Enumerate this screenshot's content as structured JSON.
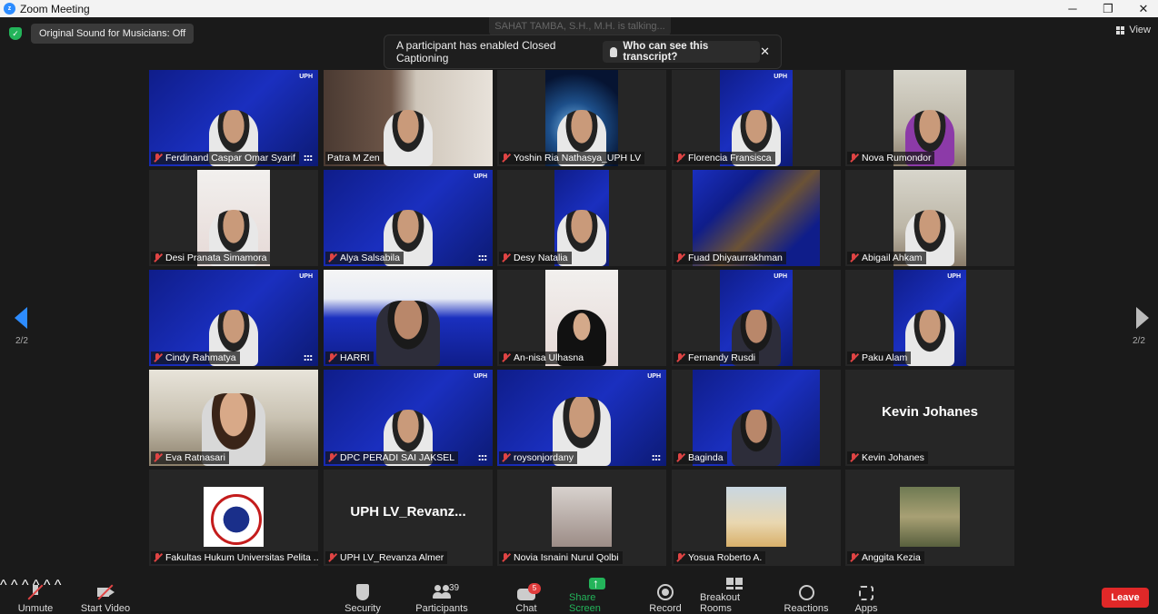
{
  "window": {
    "title": "Zoom Meeting",
    "minimize": "─",
    "maximize": "❐",
    "close": "✕"
  },
  "top": {
    "original_sound": "Original Sound for Musicians: Off",
    "view_label": "View",
    "talking_indicator": "SAHAT TAMBA, S.H., M.H. is talking...",
    "cc_banner": {
      "message": "A participant has enabled Closed Captioning",
      "who_button": "Who can see this transcript?",
      "close": "✕"
    }
  },
  "pagination": {
    "left": "2/2",
    "right": "2/2"
  },
  "tiles": [
    {
      "name": "Ferdinand Caspar Omar Syarif",
      "label": "",
      "brand": "UPH"
    },
    {
      "name": "Patra M Zen",
      "label": "",
      "brand": ""
    },
    {
      "name": "Yoshin Ria Nathasya_UPH LV",
      "label": "",
      "brand": ""
    },
    {
      "name": "Florencia Fransisca",
      "label": "",
      "brand": "UPH"
    },
    {
      "name": "Nova Rumondor",
      "label": "",
      "brand": ""
    },
    {
      "name": "Desi Pranata Simamora",
      "label": "",
      "brand": ""
    },
    {
      "name": "Alya Salsabila",
      "label": "",
      "brand": "UPH"
    },
    {
      "name": "Desy Natalia",
      "label": "",
      "brand": ""
    },
    {
      "name": "Fuad Dhiyaurrakhman",
      "label": "",
      "brand": ""
    },
    {
      "name": "Abigail Ahkam",
      "label": "",
      "brand": ""
    },
    {
      "name": "Cindy Rahmatya",
      "label": "",
      "brand": "UPH"
    },
    {
      "name": "HARRI",
      "label": "",
      "brand": ""
    },
    {
      "name": "An-nisa Ulhasna",
      "label": "",
      "brand": ""
    },
    {
      "name": "Fernandy Rusdi",
      "label": "",
      "brand": "UPH"
    },
    {
      "name": "Paku Alam",
      "label": "",
      "brand": "UPH"
    },
    {
      "name": "Eva Ratnasari",
      "label": "",
      "brand": ""
    },
    {
      "name": "DPC PERADI SAI JAKSEL",
      "label": "",
      "brand": "UPH"
    },
    {
      "name": "roysonjordany",
      "label": "",
      "brand": "UPH"
    },
    {
      "name": "Baginda",
      "label": "",
      "brand": ""
    },
    {
      "name": "Kevin Johanes",
      "label": "Kevin Johanes",
      "brand": ""
    },
    {
      "name": "Fakultas Hukum Universitas Pelita ...",
      "label": "",
      "brand": ""
    },
    {
      "name": "UPH LV_Revanza Almer",
      "label": "UPH  LV_Revanz...",
      "brand": ""
    },
    {
      "name": "Novia Isnaini Nurul Qolbi",
      "label": "",
      "brand": ""
    },
    {
      "name": "Yosua Roberto A.",
      "label": "",
      "brand": ""
    },
    {
      "name": "Anggita Kezia",
      "label": "",
      "brand": ""
    }
  ],
  "toolbar": {
    "unmute": "Unmute",
    "start_video": "Start Video",
    "security": "Security",
    "participants": "Participants",
    "participants_count": "39",
    "chat": "Chat",
    "chat_badge": "5",
    "share_screen": "Share Screen",
    "record": "Record",
    "breakout_rooms": "Breakout Rooms",
    "reactions": "Reactions",
    "apps": "Apps",
    "leave": "Leave",
    "caret": "^"
  },
  "colors": {
    "accent": "#2d8cff",
    "share": "#23b45a",
    "leave": "#e02828",
    "muted": "#e04444"
  }
}
